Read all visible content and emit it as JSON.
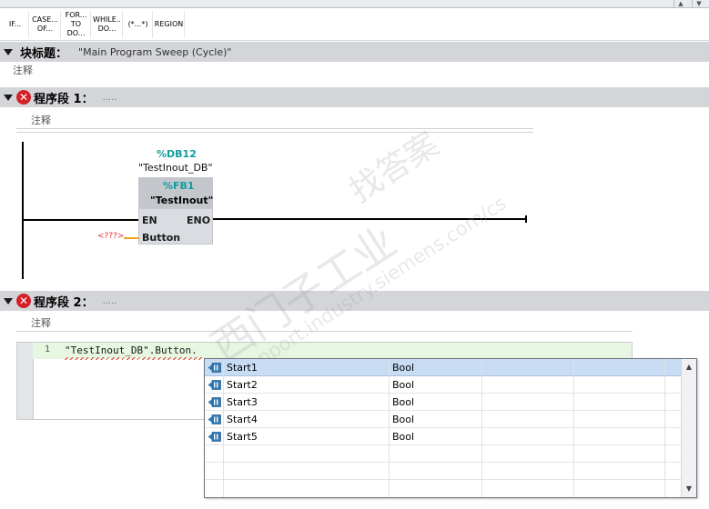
{
  "toolbar": {
    "buttons": [
      {
        "line1": "IF...",
        "line2": ""
      },
      {
        "line1": "CASE...",
        "line2": "OF..."
      },
      {
        "line1": "FOR...",
        "line2": "TO DO..."
      },
      {
        "line1": "WHILE..",
        "line2": "DO..."
      },
      {
        "line1": "(*...*)",
        "line2": ""
      },
      {
        "line1": "REGION",
        "line2": ""
      }
    ]
  },
  "block": {
    "title_label": "块标题：",
    "title_value": "\"Main Program Sweep (Cycle)\"",
    "comment": "注释"
  },
  "network1": {
    "label": "程序段 1：",
    "dots": ".....",
    "comment": "注释",
    "db_address": "%DB12",
    "db_name": "\"TestInout_DB\"",
    "fb_address": "%FB1",
    "fb_name": "\"TestInout\"",
    "pin_en": "EN",
    "pin_eno": "ENO",
    "pin_button": "Button",
    "unconnected": "<???>"
  },
  "network2": {
    "label": "程序段 2：",
    "dots": ".....",
    "comment": "注释",
    "line_number": "1",
    "code": "\"TestInout_DB\".Button."
  },
  "autocomplete": {
    "items": [
      {
        "name": "Start1",
        "type": "Bool"
      },
      {
        "name": "Start2",
        "type": "Bool"
      },
      {
        "name": "Start3",
        "type": "Bool"
      },
      {
        "name": "Start4",
        "type": "Bool"
      },
      {
        "name": "Start5",
        "type": "Bool"
      }
    ],
    "selected_index": 0
  },
  "watermark": {
    "line1": "找答案",
    "line2": "西门子工业",
    "line3": "support.industry.siemens.com/cs"
  },
  "colors": {
    "accent_teal": "#119ca0",
    "error_red": "#d32228",
    "header_gray": "#d3d5d8",
    "selection_blue": "#c8dcf4"
  }
}
